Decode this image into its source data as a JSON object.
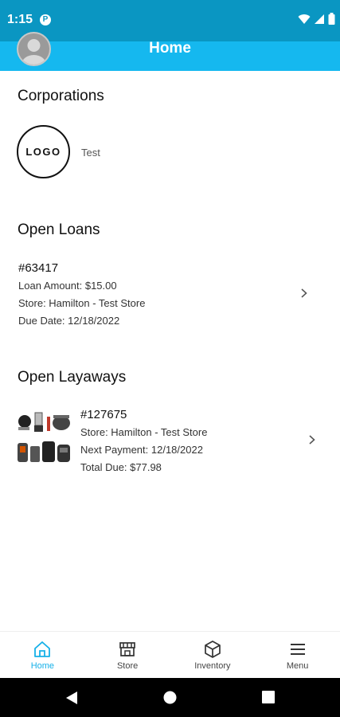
{
  "status_bar": {
    "time": "1:15",
    "app_icon": "P"
  },
  "header": {
    "title": "Home"
  },
  "corporations": {
    "title": "Corporations",
    "items": [
      {
        "logo_text": "LOGO",
        "name": "Test"
      }
    ]
  },
  "open_loans": {
    "title": "Open Loans",
    "items": [
      {
        "number": "#63417",
        "amount": "Loan Amount: $15.00",
        "store": "Store: Hamilton - Test Store",
        "due_date": "Due Date: 12/18/2022"
      }
    ]
  },
  "open_layaways": {
    "title": "Open Layaways",
    "items": [
      {
        "number": "#127675",
        "store": "Store: Hamilton - Test Store",
        "next_payment": "Next Payment: 12/18/2022",
        "total_due": "Total Due: $77.98"
      }
    ]
  },
  "bottom_nav": {
    "items": [
      {
        "label": "Home",
        "icon": "home-icon",
        "active": true
      },
      {
        "label": "Store",
        "icon": "store-icon",
        "active": false
      },
      {
        "label": "Inventory",
        "icon": "box-icon",
        "active": false
      },
      {
        "label": "Menu",
        "icon": "menu-icon",
        "active": false
      }
    ]
  },
  "colors": {
    "status_bar": "#0a96c2",
    "header": "#15b8ef",
    "accent": "#15b0e8"
  }
}
